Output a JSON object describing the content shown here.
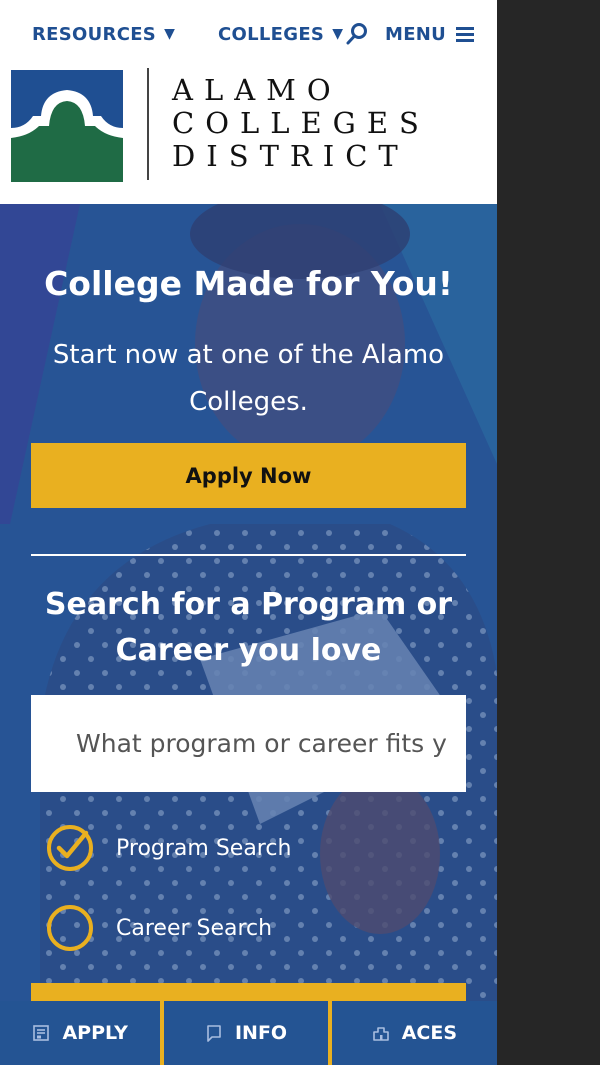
{
  "colors": {
    "brand_blue": "#1f4f92",
    "hero_blue": "#245493",
    "gold": "#e9b020",
    "logo_green": "#1f6b45",
    "logo_blue": "#1f4f92",
    "side_panel": "#262626"
  },
  "topnav": {
    "resources_label": "RESOURCES",
    "colleges_label": "COLLEGES",
    "menu_label": "MENU",
    "icons": [
      "caret-down-icon",
      "search-icon",
      "hamburger-icon"
    ]
  },
  "logo": {
    "line1": "ALAMO",
    "line2": "COLLEGES",
    "line3": "DISTRICT"
  },
  "hero": {
    "title": "College Made for You!",
    "subtitle": "Start now at one of the Alamo Colleges.",
    "apply_button": "Apply Now",
    "search_heading": "Search for a Program or Career you love",
    "search_placeholder": "What program or career fits you?",
    "options": [
      {
        "label": "Program Search",
        "selected": true
      },
      {
        "label": "Career Search",
        "selected": false
      }
    ]
  },
  "bottom_bar": {
    "tabs": [
      {
        "label": "APPLY",
        "icon": "form-icon"
      },
      {
        "label": "INFO",
        "icon": "bookmark-icon"
      },
      {
        "label": "ACES",
        "icon": "building-icon"
      }
    ]
  }
}
